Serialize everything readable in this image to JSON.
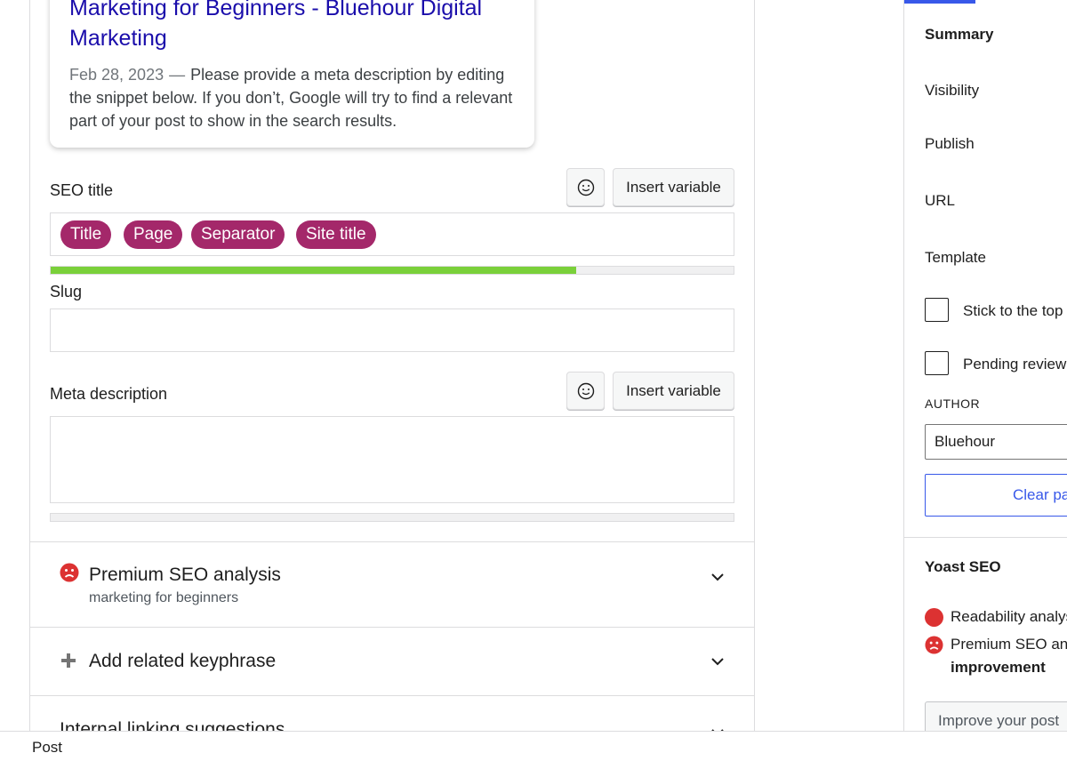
{
  "snippet": {
    "title": "Marketing for Beginners - Bluehour Digital Marketing",
    "date": "Feb 28, 2023",
    "separator": "—",
    "description": "Please provide a meta description by editing the snippet below. If you don’t, Google will try to find a relevant part of your post to show in the search results."
  },
  "seo_title": {
    "label": "SEO title",
    "insert_label": "Insert variable",
    "pills": [
      "Title",
      "Page",
      "Separator",
      "Site title"
    ],
    "progress": 0.77,
    "progress_color": "#7ad03a"
  },
  "slug": {
    "label": "Slug",
    "value": ""
  },
  "meta_description": {
    "label": "Meta description",
    "insert_label": "Insert variable",
    "value": ""
  },
  "sections": {
    "premium_analysis": {
      "title": "Premium SEO analysis",
      "subtitle": "marketing for beginners",
      "icon": "sad-face-icon"
    },
    "related_keyphrase": {
      "title": "Add related keyphrase",
      "icon": "plus-icon"
    },
    "internal_linking": {
      "title": "Internal linking suggestions"
    }
  },
  "sidebar": {
    "summary": "Summary",
    "visibility": "Visibility",
    "publish": "Publish",
    "url": "URL",
    "template": "Template",
    "stick_to_top": "Stick to the top of the blog",
    "pending_review": "Pending review",
    "author_label": "AUTHOR",
    "author_value": "Bluehour",
    "clear_button": "Clear page template",
    "yoast_heading": "Yoast SEO",
    "readability": "Readability analysis",
    "premium_seo_prefix": "Premium SEO analysis:",
    "premium_seo_status": "improvement",
    "improve_button": "Improve your post"
  },
  "colors": {
    "accent": "#3858e9",
    "pill": "#a4286a",
    "link": "#1a0dab",
    "bad": "#dc3232"
  },
  "status_bar": {
    "label": "Post"
  }
}
